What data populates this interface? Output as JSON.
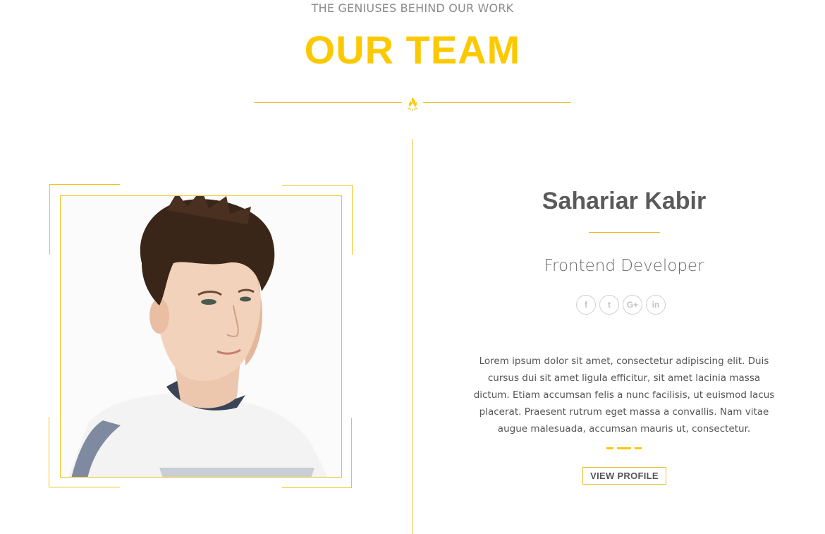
{
  "header": {
    "subtitle": "THE GENIUSES BEHIND OUR WORK",
    "title": "OUR TEAM"
  },
  "member": {
    "name": "Sahariar Kabir",
    "role": "Frontend Developer",
    "bio": "Lorem ipsum dolor sit amet, consectetur adipiscing elit. Duis cursus dui sit amet ligula efficitur, sit amet lacinia massa dictum. Etiam accumsan felis a nunc facilisis, ut euismod lacus placerat. Praesent rutrum eget massa a convallis. Nam vitae augue malesuada, accumsan mauris ut, consectetur.",
    "view_profile_label": "VIEW PROFILE",
    "socials": [
      {
        "icon": "facebook-icon",
        "glyph": "f"
      },
      {
        "icon": "twitter-icon",
        "glyph": "t"
      },
      {
        "icon": "google-plus-icon",
        "glyph": "G+"
      },
      {
        "icon": "linkedin-icon",
        "glyph": "in"
      }
    ]
  },
  "colors": {
    "accent": "#fcc900",
    "line": "#e8bf2b",
    "text": "#5a5a5a"
  }
}
